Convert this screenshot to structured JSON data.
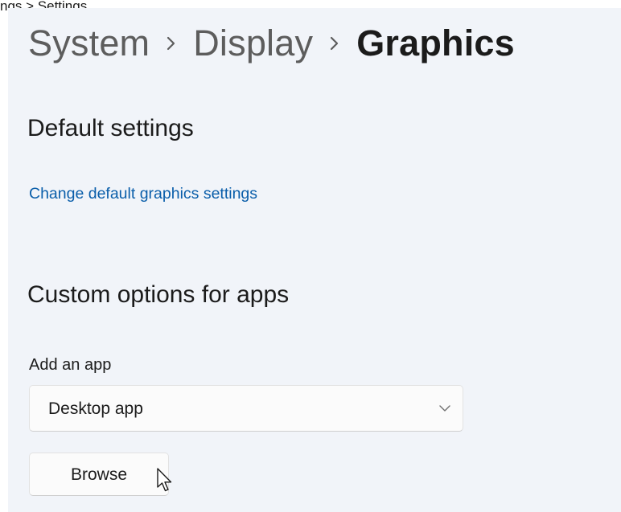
{
  "page_label": "ngs > Settings",
  "breadcrumb": {
    "items": [
      "System",
      "Display",
      "Graphics"
    ],
    "separator_icon": "chevron-right-icon"
  },
  "sections": {
    "default": {
      "title": "Default settings",
      "link": "Change default graphics settings"
    },
    "custom": {
      "title": "Custom options for apps",
      "add_label": "Add an app",
      "dropdown_value": "Desktop app",
      "dropdown_icon": "chevron-down-icon",
      "browse_label": "Browse"
    }
  },
  "colors": {
    "panel_bg": "#f1f4f9",
    "link": "#0a5eaa",
    "crumb_inactive": "#5d5d5d",
    "text": "#1b1b1b"
  },
  "cursor_icon": "mouse-pointer-icon"
}
